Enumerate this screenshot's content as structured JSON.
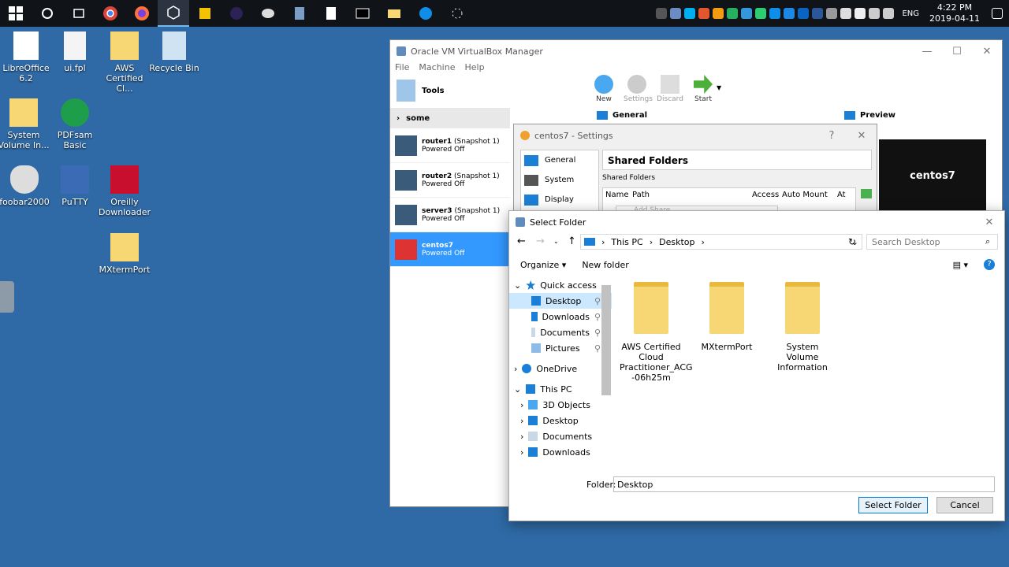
{
  "taskbar": {
    "clock_time": "4:22 PM",
    "clock_date": "2019-04-11",
    "language": "ENG"
  },
  "desktop": {
    "icons": [
      {
        "label": "LibreOffice 6.2"
      },
      {
        "label": "ui.fpl"
      },
      {
        "label": "AWS Certified Cl..."
      },
      {
        "label": "Recycle Bin"
      },
      {
        "label": "System Volume In..."
      },
      {
        "label": "PDFsam Basic"
      },
      {
        "label": "foobar2000"
      },
      {
        "label": "PuTTY"
      },
      {
        "label": "Oreilly Downloader"
      },
      {
        "label": "MXtermPort"
      }
    ]
  },
  "vbox": {
    "title": "Oracle VM VirtualBox Manager",
    "menu": [
      "File",
      "Machine",
      "Help"
    ],
    "tools_label": "Tools",
    "toolbar": {
      "new": "New",
      "settings": "Settings",
      "discard": "Discard",
      "start": "Start"
    },
    "group": "some",
    "vms": [
      {
        "name": "router1",
        "snapshot": "(Snapshot 1)",
        "state": "Powered Off"
      },
      {
        "name": "router2",
        "snapshot": "(Snapshot 1)",
        "state": "Powered Off"
      },
      {
        "name": "server3",
        "snapshot": "(Snapshot 1)",
        "state": "Powered Off"
      },
      {
        "name": "centos7",
        "snapshot": "",
        "state": "Powered Off"
      }
    ],
    "general_label": "General",
    "preview_label": "Preview",
    "preview_vm": "centos7"
  },
  "settings": {
    "title": "centos7 - Settings",
    "help": "?",
    "nav": [
      "General",
      "System",
      "Display"
    ],
    "section_title": "Shared Folders",
    "shared_folders_label": "Shared Folders",
    "columns": [
      "Name",
      "Path",
      "Access",
      "Auto Mount",
      "At"
    ],
    "add_share": "Add Share"
  },
  "dialog": {
    "title": "Select Folder",
    "path": [
      "This PC",
      "Desktop"
    ],
    "search_placeholder": "Search Desktop",
    "organize": "Organize",
    "new_folder": "New folder",
    "tree": {
      "quick_access": "Quick access",
      "qa_items": [
        "Desktop",
        "Downloads",
        "Documents",
        "Pictures"
      ],
      "onedrive": "OneDrive",
      "this_pc": "This PC",
      "pc_items": [
        "3D Objects",
        "Desktop",
        "Documents",
        "Downloads"
      ]
    },
    "files": [
      {
        "name": "AWS Certified Cloud Practitioner_ACG -06h25m"
      },
      {
        "name": "MXtermPort"
      },
      {
        "name": "System Volume Information"
      }
    ],
    "folder_label": "Folder:",
    "folder_value": "Desktop",
    "select_button": "Select Folder",
    "cancel_button": "Cancel"
  }
}
